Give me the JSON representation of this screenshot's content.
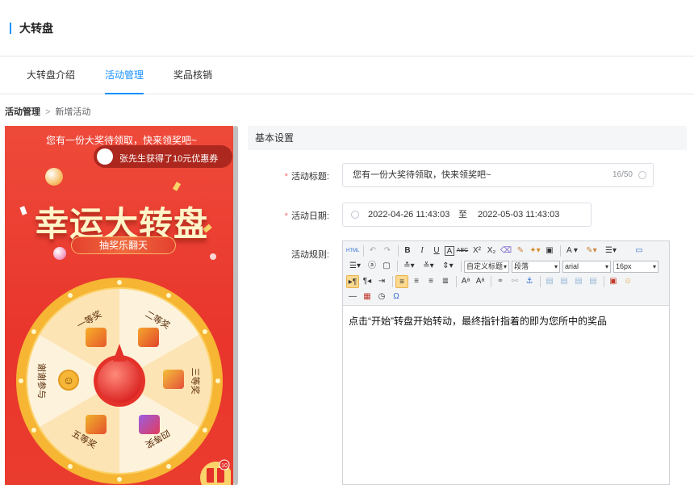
{
  "header": {
    "title": "大转盘"
  },
  "tabs": [
    {
      "label": "大转盘介绍"
    },
    {
      "label": "活动管理",
      "active": true
    },
    {
      "label": "奖品核销"
    }
  ],
  "breadcrumb": {
    "parent": "活动管理",
    "separator": ">",
    "current": "新增活动"
  },
  "preview": {
    "top_text": "您有一份大奖待领取，快来领奖吧~",
    "notice": "张先生获得了10元优惠券",
    "title": "幸运大转盘",
    "subtitle": "抽奖乐翻天",
    "prizes": [
      "一等奖",
      "二等奖",
      "三等奖",
      "四等奖",
      "五等奖",
      "谢谢参与"
    ],
    "badge_count": "10",
    "colors": {
      "bg": "#ea3c2e",
      "wheel_rim": "#f6b533",
      "slice_light": "#fdf2dc",
      "slice_warm": "#fde4b4"
    }
  },
  "settings": {
    "section_title": "基本设置",
    "title_label": "活动标题:",
    "title_value": "您有一份大奖待领取，快来领奖吧~",
    "title_count": "16/50",
    "date_label": "活动日期:",
    "date_start": "2022-04-26 11:43:03",
    "date_to": "至",
    "date_end": "2022-05-03 11:43:03",
    "rules_label": "活动规则:",
    "required_mark": "*"
  },
  "editor": {
    "heading_select": "自定义标题",
    "paragraph_select": "段落",
    "font_select": "arial",
    "size_select": "16px",
    "content": "点击“开始”转盘开始转动，最终指针指着的即为您所中的奖品"
  },
  "accent_color": "#1890ff"
}
